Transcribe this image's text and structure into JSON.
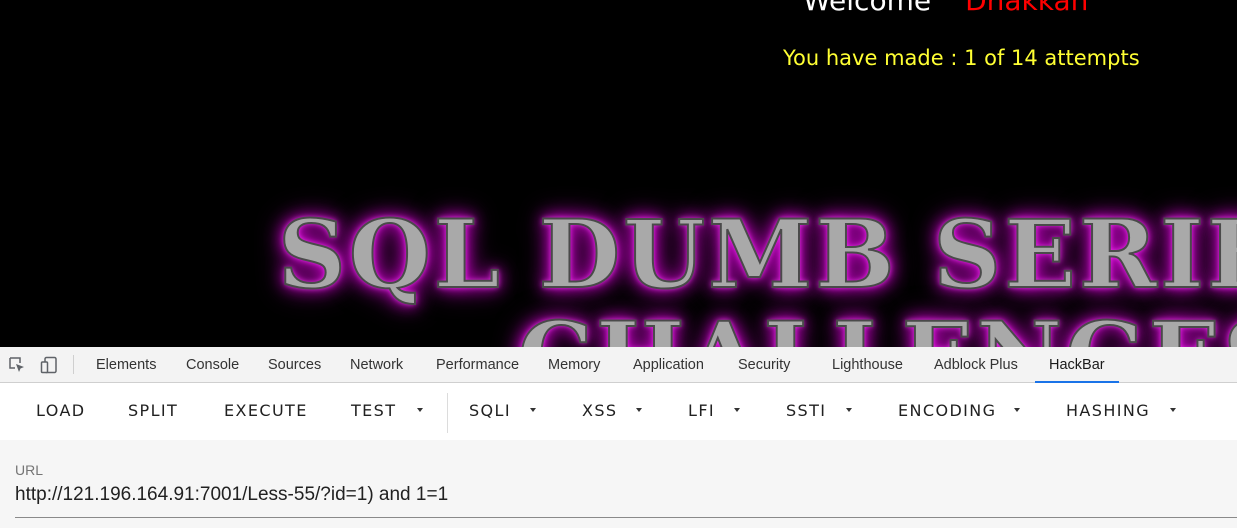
{
  "page": {
    "welcome": "Welcome",
    "username": "Dhakkan",
    "attempts_text": "You have made : 1 of 14 attempts",
    "banner_line1": "SQL DUMB SERIES",
    "banner_line2": "CHALLENGES"
  },
  "devtools": {
    "icons": [
      "inspect-element-icon",
      "device-toolbar-icon"
    ],
    "tabs": [
      {
        "label": "Elements"
      },
      {
        "label": "Console"
      },
      {
        "label": "Sources"
      },
      {
        "label": "Network"
      },
      {
        "label": "Performance"
      },
      {
        "label": "Memory"
      },
      {
        "label": "Application"
      },
      {
        "label": "Security"
      },
      {
        "label": "Lighthouse"
      },
      {
        "label": "Adblock Plus"
      },
      {
        "label": "HackBar"
      }
    ],
    "active_tab": "HackBar",
    "accent_color": "#1a73e8"
  },
  "hackbar": {
    "buttons": [
      {
        "label": "LOAD"
      },
      {
        "label": "SPLIT"
      },
      {
        "label": "EXECUTE"
      },
      {
        "label": "TEST",
        "dropdown": true
      },
      {
        "label": "SQLI",
        "dropdown": true
      },
      {
        "label": "XSS",
        "dropdown": true
      },
      {
        "label": "LFI",
        "dropdown": true
      },
      {
        "label": "SSTI",
        "dropdown": true
      },
      {
        "label": "ENCODING",
        "dropdown": true
      },
      {
        "label": "HASHING",
        "dropdown": true
      }
    ],
    "url_label": "URL",
    "url_value": "http://121.196.164.91:7001/Less-55/?id=1) and 1=1"
  },
  "colors": {
    "welcome": "#ffffff",
    "username": "#ff0000",
    "attempts": "#ffff33",
    "banner_glow": "#d000d0"
  }
}
